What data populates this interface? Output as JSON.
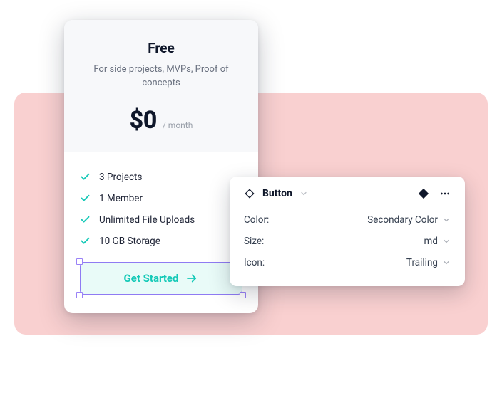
{
  "pricing": {
    "plan_name": "Free",
    "subtitle": "For side projects, MVPs, Proof of concepts",
    "price": "$0",
    "period": "/ month",
    "features": [
      "3 Projects",
      "1 Member",
      "Unlimited File Uploads",
      "10 GB Storage"
    ],
    "cta_label": "Get Started"
  },
  "inspector": {
    "component_label": "Button",
    "properties": [
      {
        "label": "Color:",
        "value": "Secondary Color"
      },
      {
        "label": "Size:",
        "value": "md"
      },
      {
        "label": "Icon:",
        "value": "Trailing"
      }
    ]
  }
}
